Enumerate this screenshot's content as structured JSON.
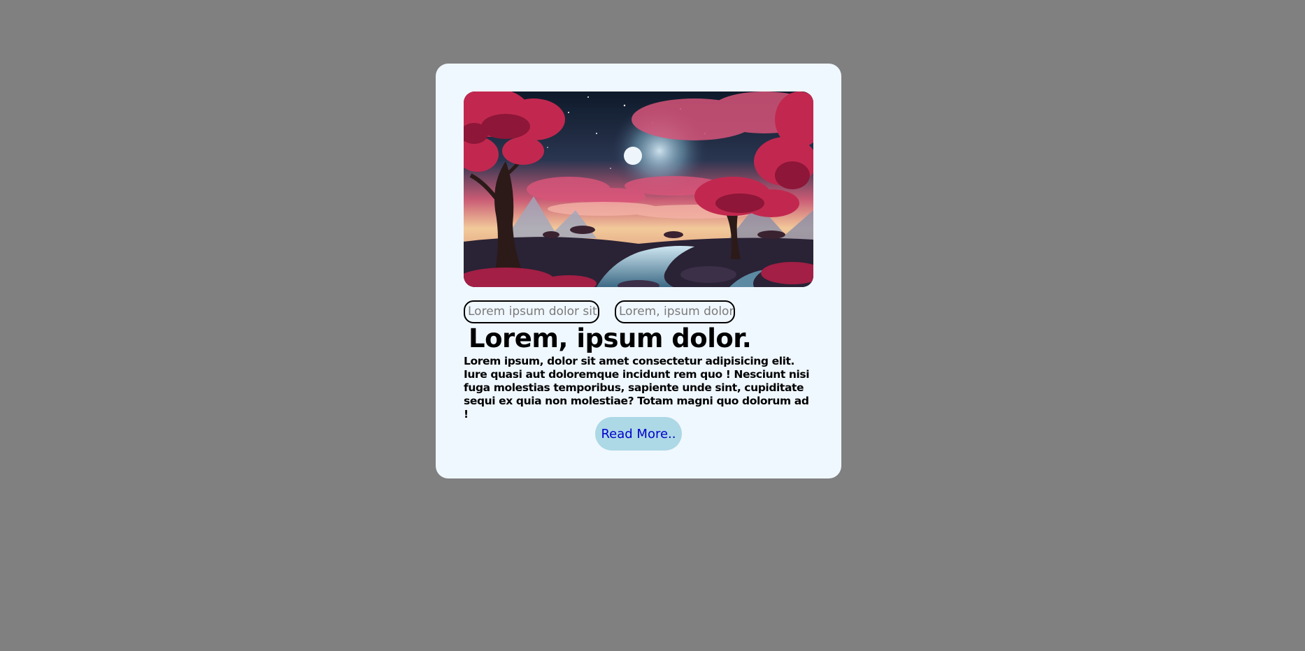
{
  "card": {
    "image_alt": "Fantasy landscape with pink trees, a river and a moon",
    "tags": [
      "Lorem ipsum dolor sit.",
      "Lorem, ipsum dolor."
    ],
    "title": "Lorem, ipsum dolor.",
    "description": "Lorem ipsum, dolor sit amet consectetur adipisicing elit. Iure quasi aut doloremque incidunt rem quo ! Nesciunt nisi fuga molestias temporibus, sapiente unde sint, cupiditate sequi ex quia non molestiae? Totam magni quo dolorum ad !",
    "button_label": "Read More.."
  },
  "colors": {
    "page_background": "#808080",
    "card_background": "#f0f8ff",
    "button_background": "#add8e6",
    "button_text": "#0000cd",
    "tag_text": "#7a7a7a"
  }
}
